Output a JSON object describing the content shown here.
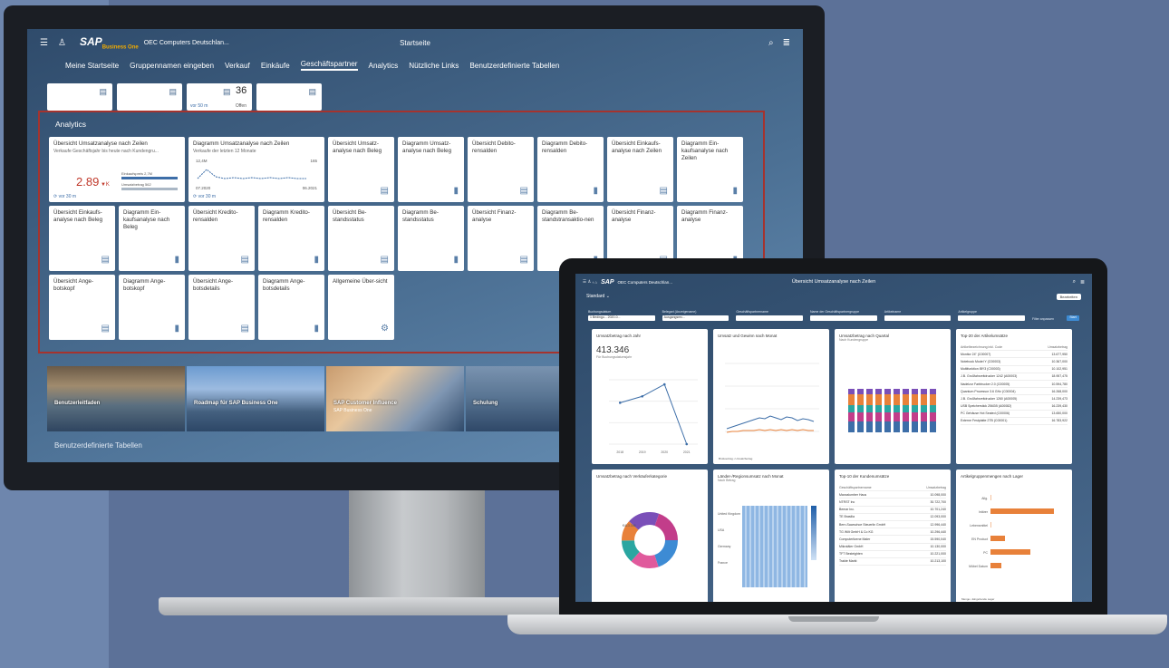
{
  "monitor": {
    "shell": {
      "logo": "SAP",
      "logo_sub": "Business One",
      "company": "OEC Computers Deutschlan...",
      "title": "Startseite"
    },
    "tabs": [
      "Meine Startseite",
      "Gruppennamen eingeben",
      "Verkauf",
      "Einkäufe",
      "Geschäftspartner",
      "Analytics",
      "Nützliche Links",
      "Benutzerdefinierte Tabellen"
    ],
    "active_tab_index": 4,
    "top_tiles": {
      "count_value": "36",
      "count_foot": "vor 50 m",
      "count_foot2": "Offen"
    },
    "analytics": {
      "title": "Analytics",
      "tiles": [
        {
          "title": "Übersicht Umsatzanalyse nach Zeilen",
          "sub": "Verkaufe Geschäftsjahr bis heute nach Kundengru...",
          "kind": "kpi",
          "kpi": "2.89",
          "kpi_unit": "K",
          "bar1_label": "Einkaufspreis",
          "bar1_val": "2,7M",
          "bar2_label": "Umsatzbetrag",
          "bar2_val": "562",
          "foot": "vor 30 m"
        },
        {
          "title": "Diagramm Umsatzanalyse nach Zeilen",
          "sub": "Verkaufe der letzten 12 Monate",
          "kind": "spark",
          "top_left": "12,4M",
          "top_right": "165",
          "bot_left": "07.2020",
          "bot_right": "06.2021",
          "foot": "vor 30 m"
        },
        {
          "title": "Übersicht Umsatz-analyse nach Beleg",
          "kind": "table"
        },
        {
          "title": "Diagramm Umsatz-analyse nach Beleg",
          "kind": "chart"
        },
        {
          "title": "Übersicht Debito-rensalden",
          "kind": "table"
        },
        {
          "title": "Diagramm Debito-rensalden",
          "kind": "chart"
        },
        {
          "title": "Übersicht Einkaufs-analyse nach Zeilen",
          "kind": "table"
        },
        {
          "title": "Diagramm Ein-kaufsanalyse nach Zeilen",
          "kind": "chart"
        },
        {
          "title": "Übersicht Einkaufs-analyse nach Beleg",
          "kind": "table"
        },
        {
          "title": "Diagramm Ein-kaufsanalyse nach Beleg",
          "kind": "chart"
        },
        {
          "title": "Übersicht Kredito-rensalden",
          "kind": "table"
        },
        {
          "title": "Diagramm Kredito-rensalden",
          "kind": "chart"
        },
        {
          "title": "Übersicht Be-standsstatus",
          "kind": "table"
        },
        {
          "title": "Diagramm Be-standsstatus",
          "kind": "chart"
        },
        {
          "title": "Übersicht Finanz-analyse",
          "kind": "table"
        },
        {
          "title": "Diagramm Be-standstransaktio-nen",
          "kind": "chart"
        },
        {
          "title": "Übersicht Finanz-analyse",
          "kind": "table"
        },
        {
          "title": "Diagramm Finanz-analyse",
          "kind": "chart"
        },
        {
          "title": "Übersicht Ange-botskopf",
          "kind": "table"
        },
        {
          "title": "Diagramm Ange-botskopf",
          "kind": "chart"
        },
        {
          "title": "Übersicht Ange-botsdetails",
          "kind": "table"
        },
        {
          "title": "Diagramm Ange-botsdetails",
          "kind": "chart"
        },
        {
          "title": "Allgemeine Über-sicht",
          "kind": "general"
        }
      ]
    },
    "banners": [
      {
        "title": "Benutzerleitfaden",
        "sub": ""
      },
      {
        "title": "Roadmap für SAP Business One",
        "sub": ""
      },
      {
        "title": "SAP Customer Influence",
        "sub": "SAP Business One"
      },
      {
        "title": "Schulung",
        "sub": ""
      }
    ],
    "section_custom": "Benutzerdefinierte Tabellen"
  },
  "laptop": {
    "shell": {
      "logo": "SAP",
      "company": "OEC Computers Deutschlan...",
      "title": "Übersicht Umsatzanalyse nach Zeilen"
    },
    "variant": "Standard",
    "edit": "Bearbeiten",
    "filters": [
      {
        "label": "Buchungsdatum",
        "value": "1 Bedingu... 2020-0..."
      },
      {
        "label": "Belegart (Anzeigename)",
        "value": "Ausgangsrec..."
      },
      {
        "label": "Geschäftspartnername",
        "value": ""
      },
      {
        "label": "Name der Geschäftspartnergruppe",
        "value": ""
      },
      {
        "label": "Artikelname",
        "value": ""
      },
      {
        "label": "Artikelgruppe",
        "value": ""
      }
    ],
    "filter_hide": "Filter anpassen",
    "go": "Start",
    "cards": {
      "c1": {
        "title": "Umsatzbetrag nach Jahr",
        "value": "413.346",
        "sub": "Für Buchungsdatumsjahr"
      },
      "c2": {
        "title": "Umsatz und Gewinn nach Monat",
        "legend": "Bruttoertrag • Umsatzbetrag"
      },
      "c3": {
        "title": "Umsatzbetrag nach Quartal",
        "sub": "Nach Kundengruppe"
      },
      "c4": {
        "title": "Top-20 der Artikelumsätze",
        "col1": "Artikelbezeichnung inkl. Code",
        "col2": "Umsatzbetrag",
        "rows": [
          [
            "Monitor 24\" (C00007)",
            "13.677,950"
          ],
          [
            "Notebook Model Y (C00003)",
            "10.367,000"
          ],
          [
            "Multifunktion IBY3 (C00003)",
            "10.102,951"
          ],
          [
            "J.B. Großfahrzeitdrucker 1242 (A00003)",
            "18.957,475"
          ],
          [
            "Nadelzur Farbtrucker 2.0 (C00005)",
            "10.594,780"
          ],
          [
            "Quantum Prozessor 3.6 GHz (C00004)",
            "16.268,000"
          ],
          [
            "J.B. Großfahrzeitdrucker 1260 (A00005)",
            "14.239,473"
          ],
          [
            "USB Speicherstick 256GB (A00082)",
            "16.239,430"
          ],
          [
            "PC Gehäuse Hot Seated (C00006)",
            "13.650,000"
          ],
          [
            "Externe Festplatte 2TB (C00001)",
            "16.783,922"
          ]
        ]
      },
      "c5": {
        "title": "Umsatzbetrag nach Verkäuferkategorie",
        "center_value": "€413.346"
      },
      "c6": {
        "title": "Länder-/Regionsumsatz nach Monat",
        "sub": "Nach Betrag",
        "rows": [
          "United Kingdom",
          "USA",
          "Germany",
          "France"
        ]
      },
      "c7": {
        "title": "Top-10 der Kundenumsätze",
        "col1": "Geschäftspartnername",
        "col2": "Umsatzbetrag",
        "rows": [
          [
            "Maxxalumber Haus",
            "10.098,000"
          ],
          [
            "NTRST Inc",
            "30.722,700"
          ],
          [
            "Bemar Inc.",
            "10.701,240"
          ],
          [
            "TE Brasilia",
            "12.093,000"
          ],
          [
            "Bern-Saarschoe Steuerlin GmbH",
            "12.996,440"
          ],
          [
            "TG Wilt GmbH & Co KG",
            "10.296,440"
          ],
          [
            "Computerlizene Maler",
            "15.590,040"
          ],
          [
            "Mikrotäler GmbH",
            "10.130,000"
          ],
          [
            "TFT Besteighten",
            "10.221,000"
          ],
          [
            "Trakte Markt",
            "10.213,100"
          ]
        ]
      },
      "c8": {
        "title": "Artikelgruppenmengen nach Lager",
        "rows": [
          "Allg.",
          "Intärer",
          "Lebensmittel",
          "EN Product",
          "PC",
          "Möbel Datum"
        ],
        "legend": "Menge • Eingehende Lager"
      }
    },
    "c1_chart": {
      "x": [
        "2018",
        "2019",
        "2020",
        "2021"
      ],
      "values": [
        45,
        52,
        65,
        0
      ]
    },
    "c8_values": [
      0,
      35,
      0,
      8,
      22,
      6
    ]
  },
  "colors": {
    "accent": "#a5332e",
    "kpi": "#c0392b",
    "link": "#3d6ea8",
    "sap_gold": "#f0ab00",
    "go": "#3d8bd4"
  }
}
